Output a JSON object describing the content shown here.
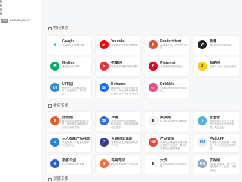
{
  "sidebar": {
    "glyphs": [
      "0",
      "0",
      "0",
      "0"
    ],
    "logo_icon": "site-logo-icon",
    "site_url": "www.wuyue.cc"
  },
  "colors": {
    "page_background": "#f6f7f8",
    "card_background": "#ffffff",
    "title_text": "#333333",
    "description_text": "#9a9a9a"
  },
  "sections": [
    {
      "title": "常用推荐",
      "icon": "tag-icon",
      "cards": [
        {
          "name": "Google",
          "desc": "全球最大的搜索引擎",
          "icon": "google-icon",
          "glyph": "G",
          "icon_bg": "#ffffff",
          "icon_fg": "#4285f4"
        },
        {
          "name": "Youtube",
          "desc": "全球最大的视频分享网站",
          "icon": "youtube-icon",
          "glyph": "▶",
          "icon_bg": "#ff0000",
          "icon_fg": "#ffffff"
        },
        {
          "name": "ProductHunt",
          "desc": "发现新产品、新创意的社区",
          "icon": "producthunt-icon",
          "glyph": "P",
          "icon_bg": "#da552f",
          "icon_fg": "#ffffff"
        },
        {
          "name": "微博",
          "desc": "随时随地发现新鲜事",
          "icon": "weibo-icon",
          "glyph": "W",
          "icon_bg": "#1f1f1f",
          "icon_fg": "#ffffff"
        },
        {
          "name": "Medium",
          "desc": "高质量设计文章",
          "icon": "medium-icon",
          "glyph": "M",
          "icon_bg": "#00ab6c",
          "icon_fg": "#ffffff"
        },
        {
          "name": "花瓣网",
          "desc": "收集灵感,保存有用的素材",
          "icon": "huaban-icon",
          "glyph": "h",
          "icon_bg": "#e8333b",
          "icon_fg": "#ffffff"
        },
        {
          "name": "Pinterest",
          "desc": "全球美图收藏采集站",
          "icon": "pinterest-icon",
          "glyph": "P",
          "icon_bg": "#e60023",
          "icon_fg": "#ffffff"
        },
        {
          "name": "站酷网",
          "desc": "中国人气设计师互动平台",
          "icon": "zcool-icon",
          "glyph": "Z",
          "icon_bg": "#ffd100",
          "icon_fg": "#333333"
        },
        {
          "name": "UI中国",
          "desc": "图形交互与界面设计交流、作品展示、学习平台。",
          "icon": "ui-china-icon",
          "glyph": "UI",
          "icon_bg": "#2a8ce0",
          "icon_fg": "#ffffff"
        },
        {
          "name": "Behance",
          "desc": "Adobe旗下的设计师交流平台，来自世界各地的设计师在这里分享自己的作品。",
          "icon": "behance-icon",
          "glyph": "Bē",
          "icon_bg": "#1769ff",
          "icon_fg": "#ffffff"
        },
        {
          "name": "Dribbble",
          "desc": "全球UI设计师作品分享平台。",
          "icon": "dribbble-icon",
          "glyph": "◎",
          "icon_bg": "#ea4c89",
          "icon_fg": "#ffffff"
        }
      ]
    },
    {
      "title": "社区资讯",
      "icon": "tag-icon",
      "cards": [
        {
          "name": "虎嗅网",
          "desc": "聚合优质的创新信息与人群，捕获精选|深度|犀利的商业科技资讯。",
          "icon": "huxiu-icon",
          "glyph": "H",
          "icon_bg": "#f15a22",
          "icon_fg": "#ffffff"
        },
        {
          "name": "36氪",
          "desc": "36氪为您提供创业资讯、科技新闻、投融资对接等创业服务",
          "icon": "36kr-icon",
          "glyph": "36",
          "icon_bg": "#2d6cdf",
          "icon_fg": "#ffffff"
        },
        {
          "name": "数英网",
          "desc": "数字媒体及职业招聘网站",
          "icon": "digitaling-icon",
          "glyph": "D",
          "icon_bg": "#f1f1f1",
          "icon_fg": "#111111"
        },
        {
          "name": "爱运营",
          "desc": "网站运营人员学习交流，专注于网站产品运营管理、淘宝运营。",
          "icon": "iyunying-icon",
          "glyph": "i",
          "icon_bg": "#4fb3e8",
          "icon_fg": "#ffffff"
        },
        {
          "name": "人人都是产品经理",
          "desc": "产品经理、产品爱好者学习交流平台",
          "icon": "woshipm-icon",
          "glyph": "A",
          "icon_bg": "#2a7de1",
          "icon_fg": "#ffffff"
        },
        {
          "name": "互联网早读课",
          "desc": "互联网行业深度阅读与学习平台",
          "icon": "zaoduke-icon",
          "glyph": "Z",
          "icon_bg": "#3a3f8f",
          "icon_fg": "#ffffff"
        },
        {
          "name": "产品壹佰",
          "desc": "为产品经理爱好者提供最优秀的产品资讯、原创内容和相关视频课程",
          "icon": "chanpin100-icon",
          "glyph": "100",
          "icon_bg": "#e8463a",
          "icon_fg": "#ffffff"
        },
        {
          "name": "PMCAFF",
          "desc": "中国第一产品经理人气组织，专注于研究互联网产品",
          "icon": "pmcaff-icon",
          "glyph": "PM",
          "icon_bg": "#e6eef5",
          "icon_fg": "#3b7fbf"
        },
        {
          "name": "极客公园",
          "desc": "科技创新者的大本营",
          "icon": "geekpark-icon",
          "glyph": "G",
          "icon_bg": "#2b5dd1",
          "icon_fg": "#ffffff"
        },
        {
          "name": "鸟哥笔记",
          "desc": "移动互联网第一干货平台",
          "icon": "niaogebiji-icon",
          "glyph": "N",
          "icon_bg": "#ff6a3d",
          "icon_fg": "#ffffff"
        },
        {
          "name": "大作",
          "desc": "设计师必备的灵感搜索引擎",
          "icon": "dazuo-icon",
          "glyph": "D",
          "icon_bg": "#ffffff",
          "icon_fg": "#111111"
        },
        {
          "name": "优阁网",
          "desc": "UGain 优阁网，是一个产品经理学习、交流、分享的平台",
          "icon": "ugain-icon",
          "glyph": "UG",
          "icon_bg": "#8fa9c8",
          "icon_fg": "#ffffff"
        }
      ]
    },
    {
      "title": "灵感采集",
      "icon": "tag-icon"
    }
  ]
}
